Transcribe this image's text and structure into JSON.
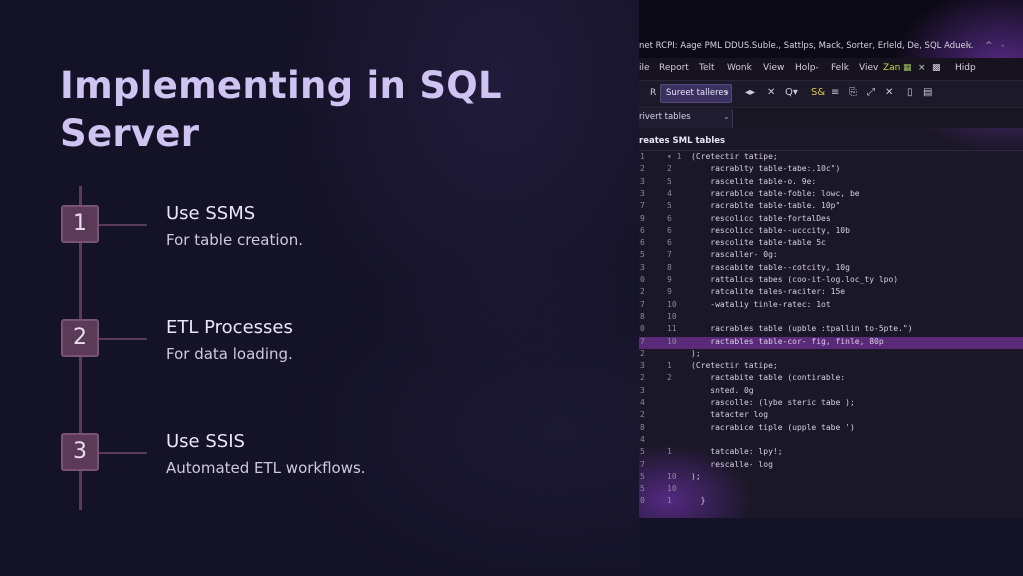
{
  "slide": {
    "title": "Implementing in SQL Server",
    "steps": [
      {
        "number": "1",
        "title": "Use SSMS",
        "description": "For table creation."
      },
      {
        "number": "2",
        "title": "ETL Processes",
        "description": "For data loading."
      },
      {
        "number": "3",
        "title": "Use SSIS",
        "description": "Automated ETL workflows."
      }
    ]
  },
  "editor": {
    "window_title": "net RCPI: Aage PML DDUS.Suble., Sattlps, Mack, Sorter, Erleld, De, SQL Aduel..",
    "window_controls": [
      "×",
      "^",
      "-"
    ],
    "menu": [
      "ile",
      "Report",
      "Telt",
      "Wonk",
      "View",
      "Holp-",
      "Felk",
      "Viev",
      "Zan",
      "Hidp"
    ],
    "toolbar": {
      "r_label": "R",
      "select_value": "Sureet talleres",
      "icons": [
        "▾",
        "◂▸",
        "✕",
        "Q▾",
        "S&",
        "≡",
        "⎘",
        "⤢",
        "✕",
        "▯",
        "▤"
      ]
    },
    "tab_label": "rivert tables",
    "section_header": "reates SML tables",
    "accent_color": "#5a2a78",
    "code_lines": [
      {
        "n1": "1",
        "n2": "▾ 1",
        "text": "(Cretectir tatipe;"
      },
      {
        "n1": "2",
        "n2": "2",
        "text": "    racrablty table-tabe:.10c\")"
      },
      {
        "n1": "3",
        "n2": "5",
        "text": "    rascelite table-o. 9e:"
      },
      {
        "n1": "3",
        "n2": "4",
        "text": "    racrablce table-foble: lowc, be"
      },
      {
        "n1": "7",
        "n2": "5",
        "text": "    racrablte table-table. 10p\""
      },
      {
        "n1": "9",
        "n2": "6",
        "text": "    rescolicc table-fortalDes"
      },
      {
        "n1": "6",
        "n2": "6",
        "text": "    rescolicc table--ucccity, 10b"
      },
      {
        "n1": "6",
        "n2": "6",
        "text": "    rescolite table-table 5c"
      },
      {
        "n1": "5",
        "n2": "7",
        "text": "    rascaller- 0g:"
      },
      {
        "n1": "3",
        "n2": "8",
        "text": "    rascabite table--cotcity, 10g"
      },
      {
        "n1": "0",
        "n2": "9",
        "text": "    rattalics tabes (coo-it-log.loc_ty lpo)"
      },
      {
        "n1": "2",
        "n2": "9",
        "text": "    ratcalite tales-raciter: 15e"
      },
      {
        "n1": "7",
        "n2": "10",
        "text": "    -wataliy tinle-ratec: 1ot"
      },
      {
        "n1": "8",
        "n2": "10",
        "text": ""
      },
      {
        "n1": "0",
        "n2": "11",
        "text": "    racrables table (upble :tpallin to-5pte.\")"
      },
      {
        "n1": "7",
        "n2": "10",
        "text": "    ractables table-cor- fig, finle, 80p",
        "highlight": true
      },
      {
        "n1": "2",
        "n2": "",
        "text": ");"
      },
      {
        "n1": "3",
        "n2": "1",
        "text": "(Cretectir tatipe;"
      },
      {
        "n1": "2",
        "n2": "2",
        "text": "    ractabite table (contirable:"
      },
      {
        "n1": "3",
        "n2": "",
        "text": "    snted. 0g"
      },
      {
        "n1": "4",
        "n2": "",
        "text": "    rascolle: (lybe steric tabe );"
      },
      {
        "n1": "2",
        "n2": "",
        "text": "    tatacter log"
      },
      {
        "n1": "8",
        "n2": "",
        "text": "    racrabice tiple (upple tabe ')"
      },
      {
        "n1": "4",
        "n2": "",
        "text": ""
      },
      {
        "n1": "5",
        "n2": "1",
        "text": "    tatcable: lpy!;"
      },
      {
        "n1": "7",
        "n2": "",
        "text": "    rescalle- log"
      },
      {
        "n1": "5",
        "n2": "10",
        "text": ");"
      },
      {
        "n1": "5",
        "n2": "10",
        "text": ""
      },
      {
        "n1": "0",
        "n2": "1",
        "text": "  }"
      }
    ]
  }
}
